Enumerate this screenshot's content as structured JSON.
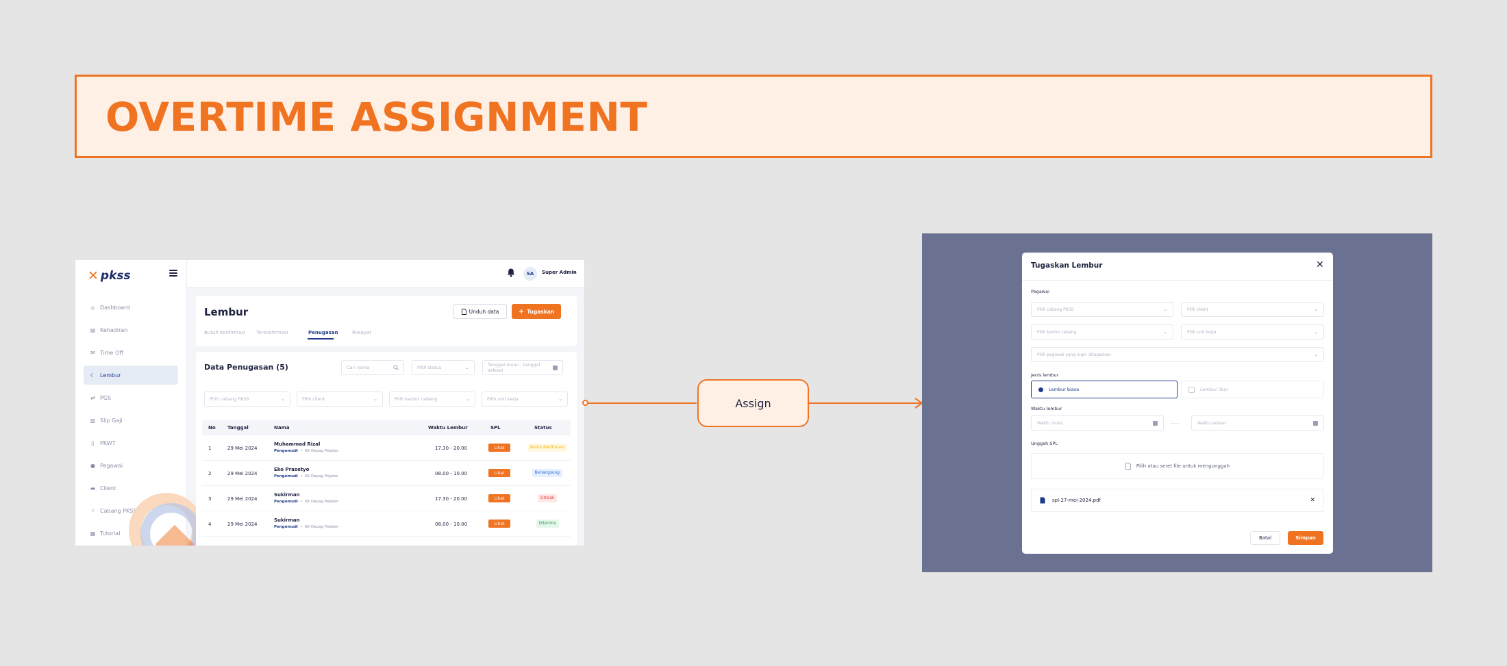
{
  "banner": {
    "title": "OVERTIME ASSIGNMENT"
  },
  "connector": {
    "label": "Assign"
  },
  "app": {
    "logo": "pkss",
    "user": {
      "initials": "SA",
      "name": "Super Admin"
    },
    "sidebar": {
      "items": [
        {
          "label": "Dashboard",
          "icon": "home-icon"
        },
        {
          "label": "Kehadiran",
          "icon": "clipboard-icon"
        },
        {
          "label": "Time Off",
          "icon": "mail-icon"
        },
        {
          "label": "Lembur",
          "icon": "moon-icon"
        },
        {
          "label": "PGS",
          "icon": "swap-icon"
        },
        {
          "label": "Slip Gaji",
          "icon": "document-icon"
        },
        {
          "label": "PKWT",
          "icon": "file-icon"
        },
        {
          "label": "Pegawai",
          "icon": "user-icon"
        },
        {
          "label": "Client",
          "icon": "briefcase-icon"
        },
        {
          "label": "Cabang PKSS",
          "icon": "branch-icon"
        },
        {
          "label": "Tutorial",
          "icon": "book-icon"
        }
      ],
      "active_index": 3
    },
    "page": {
      "title": "Lembur",
      "download_label": "Unduh data",
      "assign_label": "Tugaskan",
      "tabs": [
        "Butuh Konfirmasi",
        "Terkonfirmasi",
        "Penugasan",
        "Riwayat"
      ],
      "active_tab": 2
    },
    "table_card": {
      "title": "Data Penugasan (5)",
      "search_placeholder": "Cari nama",
      "status_placeholder": "Pilih status",
      "date_placeholder": "Tanggal mulai - tanggal selesai",
      "filters": [
        "Pilih cabang PKSS",
        "Pilih client",
        "Pilih kantor cabang",
        "Pilih unit kerja"
      ],
      "columns": [
        "No",
        "Tanggal",
        "Nama",
        "Waktu Lembur",
        "SPL",
        "Status"
      ],
      "rows": [
        {
          "no": "1",
          "date": "29 Mei 2024",
          "name": "Muhammad Rizal",
          "role": "Pengemudi",
          "place": "KK Depag Pejaten",
          "time": "17.30 - 20.00",
          "spl": "Lihat",
          "status": "Butuh Konfirmasi",
          "status_color": "#f5b400",
          "status_bg": "#fff8e0"
        },
        {
          "no": "2",
          "date": "29 Mei 2024",
          "name": "Eko Prasetyo",
          "role": "Pengemudi",
          "place": "KK Depag Pejaten",
          "time": "08.00 - 10.00",
          "spl": "Lihat",
          "status": "Berlangsung",
          "status_color": "#2b6cd4",
          "status_bg": "#e6efff"
        },
        {
          "no": "3",
          "date": "29 Mei 2024",
          "name": "Sukirman",
          "role": "Pengemudi",
          "place": "KK Depag Pejaten",
          "time": "17.30 - 20.00",
          "spl": "Lihat",
          "status": "Ditolak",
          "status_color": "#e53935",
          "status_bg": "#fde8e8"
        },
        {
          "no": "4",
          "date": "29 Mei 2024",
          "name": "Sukirman",
          "role": "Pengemudi",
          "place": "KK Depag Pejaten",
          "time": "08.00 - 10.00",
          "spl": "Lihat",
          "status": "Diterima",
          "status_color": "#2e9d4f",
          "status_bg": "#e5f6ea"
        }
      ]
    }
  },
  "modal": {
    "title": "Tugaskan Lembur",
    "pegawai_label": "Pegawai",
    "fields": {
      "cabang_pkss": "Pilih cabang PKSS",
      "client": "Pilih client",
      "kantor_cabang": "Pilih kantor cabang",
      "unit_kerja": "Pilih unit kerja",
      "pegawai": "Pilih pegawai yang ingin ditugaskan"
    },
    "jenis_label": "Jenis lembur",
    "jenis_options": [
      "Lembur biasa",
      "Lembur libur"
    ],
    "waktu_label": "Waktu lembur",
    "waktu_mulai": "Waktu mulai",
    "waktu_selesai": "Waktu selesai",
    "separator": "——",
    "upload_label": "Unggah SPL",
    "upload_prompt": "Pilih atau seret file untuk mengunggah",
    "file_name": "spl-27-mei-2024.pdf",
    "cancel_label": "Batal",
    "save_label": "Simpan"
  }
}
